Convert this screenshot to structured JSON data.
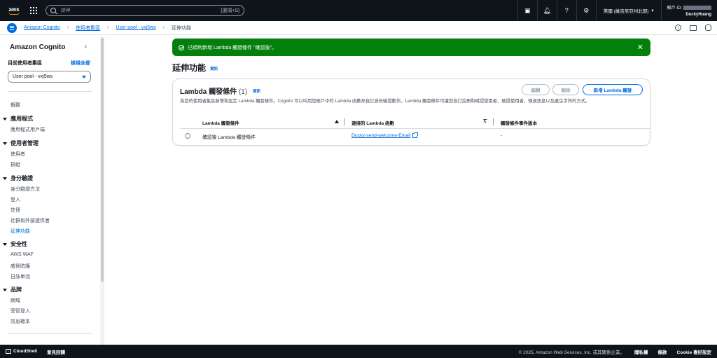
{
  "topnav": {
    "logo_text": "aws",
    "search_placeholder": "搜尋",
    "search_shortcut": "[選項+S]",
    "region": "美國 (維吉尼亞州北部)",
    "account_label": "帳戶 ID:",
    "user": "DuckyHuang"
  },
  "breadcrumb": {
    "items": [
      "Amazon Cognito",
      "使用者集區",
      "User pool - vxj5ws",
      "延伸功能"
    ]
  },
  "sidebar": {
    "title": "Amazon Cognito",
    "pool_label": "目前使用者集區",
    "view_all": "檢視全部",
    "selected_pool": "User pool - vxj5ws",
    "overview": "概觀",
    "sections": [
      {
        "title": "應用程式",
        "items": [
          "應用程式用戶端"
        ]
      },
      {
        "title": "使用者管理",
        "items": [
          "使用者",
          "群組"
        ]
      },
      {
        "title": "身分驗證",
        "items": [
          "身分驗證方法",
          "登入",
          "註冊",
          "社群和外部提供者",
          "延伸功能"
        ]
      },
      {
        "title": "安全性",
        "items": [
          "AWS WAF",
          "威脅防護",
          "日誌串流"
        ]
      },
      {
        "title": "品牌",
        "items": [
          "網域",
          "受管登入",
          "訊息範本"
        ]
      }
    ]
  },
  "flash": {
    "message": "已順利新增 Lambda 觸發條件 \"確認後\"。"
  },
  "page": {
    "title": "延伸功能",
    "info": "資訊"
  },
  "card": {
    "title": "Lambda 觸發條件",
    "count": "(1)",
    "info": "資訊",
    "description": "為您的使用者集區新增和設定 Lambda 觸發條件。Cognito 可以叫用您帳戶中的 Lambda 函數來自訂身份驗證動作。Lambda 觸發條件可讓您自訂註冊和確認使用者、驗證使用者、傳送訊息以及產生字符的方式。",
    "buttons": {
      "edit": "編輯",
      "delete": "刪除",
      "add": "新增 Lambda 觸發"
    },
    "columns": [
      "Lambda 觸發條件",
      "連接的 Lambda 函數",
      "觸發條件事件版本"
    ],
    "rows": [
      {
        "trigger": "確認後 Lambda 觸發條件",
        "function": "Ducky-send-welcome-Email",
        "version": "-"
      }
    ]
  },
  "footer": {
    "cloudshell": "CloudShell",
    "feedback": "意見回饋",
    "copyright": "© 2025, Amazon Web Services, Inc. 或其關係企業。",
    "privacy": "隱私權",
    "terms": "條款",
    "cookie": "Cookie 喜好設定"
  }
}
